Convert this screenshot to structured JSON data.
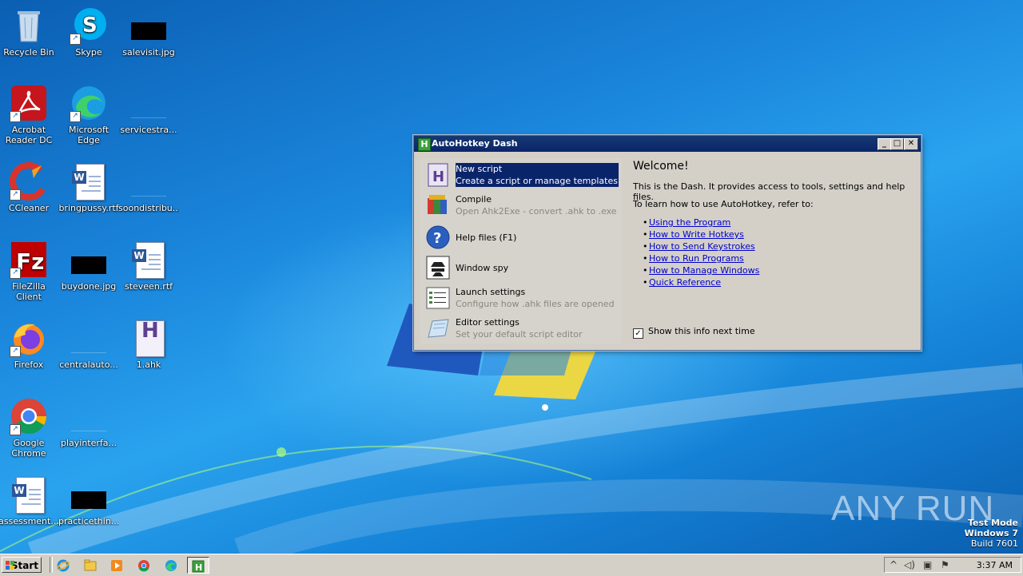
{
  "desktop": {
    "icons": [
      {
        "label": "Recycle Bin"
      },
      {
        "label": "Skype"
      },
      {
        "label": "salevisit.jpg"
      },
      {
        "label": "Acrobat Reader DC"
      },
      {
        "label": "Microsoft Edge"
      },
      {
        "label": "servicestra..."
      },
      {
        "label": "CCleaner"
      },
      {
        "label": "bringpussy.rtf"
      },
      {
        "label": "soondistribu..."
      },
      {
        "label": "FileZilla Client"
      },
      {
        "label": "buydone.jpg"
      },
      {
        "label": "steveen.rtf"
      },
      {
        "label": "Firefox"
      },
      {
        "label": "centralauto..."
      },
      {
        "label": "1.ahk"
      },
      {
        "label": "Google Chrome"
      },
      {
        "label": "playinterfa..."
      },
      {
        "label": "assessment..."
      },
      {
        "label": "practicethin..."
      }
    ]
  },
  "window": {
    "title": "AutoHotkey Dash",
    "minimize": "_",
    "maximize": "□",
    "close": "✕",
    "items": [
      {
        "title": "New script",
        "subtitle": "Create a script or manage templates",
        "icon": "ahk-script-icon"
      },
      {
        "title": "Compile",
        "subtitle": "Open Ahk2Exe - convert .ahk to .exe",
        "icon": "compile-icon"
      },
      {
        "title": "Help files (F1)",
        "subtitle": "",
        "icon": "help-icon"
      },
      {
        "title": "Window spy",
        "subtitle": "",
        "icon": "spy-icon"
      },
      {
        "title": "Launch settings",
        "subtitle": "Configure how .ahk files are opened",
        "icon": "list-icon"
      },
      {
        "title": "Editor settings",
        "subtitle": "Set your default script editor",
        "icon": "editor-icon"
      }
    ],
    "welcome": "Welcome!",
    "desc1": "This is the Dash. It provides access to tools, settings and help files.",
    "desc2": "To learn how to use AutoHotkey, refer to:",
    "links": [
      "Using the Program",
      "How to Write Hotkeys",
      "How to Send Keystrokes",
      "How to Run Programs",
      "How to Manage Windows",
      "Quick Reference"
    ],
    "show_info_label": "Show this info next time",
    "show_info_checked": true
  },
  "watermark": "ANY RUN",
  "os_info": {
    "line1": "Test Mode",
    "line2": "Windows 7",
    "line3": "Build 7601"
  },
  "taskbar": {
    "start_label": "Start",
    "clock": "3:37 AM",
    "apps": [
      "internet-explorer-icon",
      "explorer-icon",
      "media-player-icon",
      "chrome-icon",
      "edge-icon",
      "autohotkey-icon"
    ]
  }
}
